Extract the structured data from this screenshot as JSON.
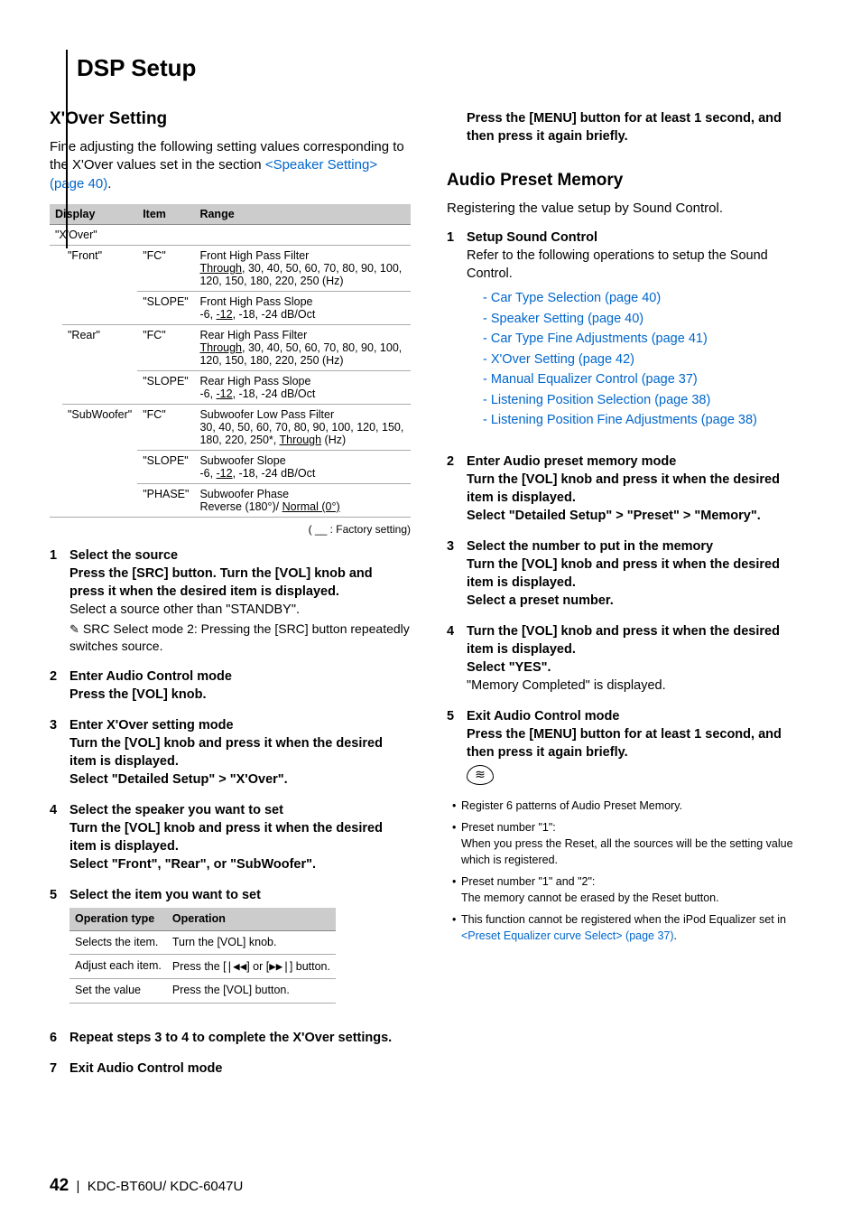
{
  "page": {
    "section_title": "DSP Setup",
    "footer_num": "42",
    "footer_sep": "|",
    "footer_models": "KDC-BT60U/ KDC-6047U"
  },
  "left": {
    "h2": "X'Over Setting",
    "intro_pre": "Fine adjusting the following setting values corresponding to the X'Over values set in the section ",
    "intro_link": "<Speaker Setting> (page 40)",
    "intro_post": ".",
    "table": {
      "headers": {
        "display": "Display",
        "item": "Item",
        "range": "Range"
      },
      "group_label": "\"X'Over\"",
      "rows": [
        {
          "display": "\"Front\"",
          "items": [
            {
              "item": "\"FC\"",
              "range_title": "Front High Pass Filter",
              "range_u": "Through",
              "range_rest": ", 30, 40, 50, 60, 70, 80, 90, 100, 120, 150, 180, 220, 250 (Hz)"
            },
            {
              "item": "\"SLOPE\"",
              "range_title": "Front High Pass Slope",
              "range_pre": "-6, ",
              "range_u": "-12",
              "range_rest": ", -18, -24 dB/Oct"
            }
          ]
        },
        {
          "display": "\"Rear\"",
          "items": [
            {
              "item": "\"FC\"",
              "range_title": "Rear High Pass Filter",
              "range_u": "Through",
              "range_rest": ", 30, 40, 50, 60, 70, 80, 90, 100, 120, 150, 180, 220, 250 (Hz)"
            },
            {
              "item": "\"SLOPE\"",
              "range_title": "Rear High Pass Slope",
              "range_pre": "-6, ",
              "range_u": "-12",
              "range_rest": ", -18, -24 dB/Oct"
            }
          ]
        },
        {
          "display": "\"SubWoofer\"",
          "items": [
            {
              "item": "\"FC\"",
              "range_title": "Subwoofer Low Pass Filter",
              "range_rest_pre": "30, 40, 50, 60, 70, 80, 90, 100, 120, 150, 180, 220, 250*, ",
              "range_u": "Through",
              "range_rest_post": " (Hz)"
            },
            {
              "item": "\"SLOPE\"",
              "range_title": "Subwoofer Slope",
              "range_pre": "-6, ",
              "range_u": "-12",
              "range_rest": ", -18, -24 dB/Oct"
            },
            {
              "item": "\"PHASE\"",
              "range_title": "Subwoofer Phase",
              "range_pre": "Reverse (180°)/ ",
              "range_u": "Normal (0°)"
            }
          ]
        }
      ]
    },
    "factory_text": "( __ : Factory setting)",
    "steps": [
      {
        "n": "1",
        "title": "Select the source",
        "bold": "Press the [SRC] button. Turn the [VOL] knob and press it when the desired item is displayed.",
        "plain": "Select a source other than \"STANDBY\".",
        "pen": "SRC Select mode 2: Pressing the [SRC] button repeatedly switches source."
      },
      {
        "n": "2",
        "title": "Enter Audio Control mode",
        "bold": "Press the [VOL] knob."
      },
      {
        "n": "3",
        "title": "Enter X'Over setting mode",
        "bold": "Turn the [VOL] knob and press it when the desired item is displayed.",
        "bold2_pre": "Select \"Detailed Setup\" ",
        "bold2_arrow": ">",
        "bold2_post": " \"X'Over\"."
      },
      {
        "n": "4",
        "title": "Select the speaker you want to set",
        "bold": "Turn the [VOL] knob and press it when the desired item is displayed.",
        "bold2": "Select \"Front\", \"Rear\", or \"SubWoofer\"."
      },
      {
        "n": "5",
        "title": "Select the item you want to set"
      },
      {
        "n": "6",
        "title": "Repeat steps 3 to 4 to complete the X'Over settings."
      },
      {
        "n": "7",
        "title": "Exit Audio Control mode"
      }
    ],
    "op_table": {
      "headers": {
        "type": "Operation type",
        "op": "Operation"
      },
      "rows": [
        {
          "type": "Selects the item.",
          "op": "Turn the [VOL] knob."
        },
        {
          "type": "Adjust each item.",
          "op_pre": "Press the [",
          "op_icon1": "|◀◀",
          "op_mid": "] or [",
          "op_icon2": "▶▶|",
          "op_post": "] button."
        },
        {
          "type": "Set the value",
          "op": "Press the [VOL] button."
        }
      ]
    }
  },
  "right": {
    "cont_bold": "Press the [MENU] button for at least 1 second, and then press it again briefly.",
    "h2": "Audio Preset Memory",
    "intro": "Registering the value setup by Sound Control.",
    "steps": [
      {
        "n": "1",
        "title": "Setup Sound Control",
        "plain": "Refer to the following operations to setup the Sound Control.",
        "links": [
          "Car Type Selection (page 40)",
          "Speaker Setting (page 40)",
          "Car Type Fine Adjustments (page 41)",
          "X'Over Setting (page 42)",
          "Manual Equalizer Control (page 37)",
          "Listening Position Selection (page 38)",
          "Listening Position Fine Adjustments (page 38)"
        ]
      },
      {
        "n": "2",
        "title": "Enter Audio preset memory mode",
        "bold": "Turn the [VOL] knob and press it when the desired item is displayed.",
        "bold2_pre": "Select \"Detailed Setup\" ",
        "arrow1": ">",
        "bold2_mid": " \"Preset\" ",
        "arrow2": ">",
        "bold2_post": " \"Memory\"."
      },
      {
        "n": "3",
        "title": "Select the number to put in the memory",
        "bold": "Turn the [VOL] knob and press it when the desired item is displayed.",
        "bold2": "Select a preset number."
      },
      {
        "n": "4",
        "title_pre": "Turn the [VOL] knob and press it when the desired item is displayed.",
        "bold2": "Select \"YES\".",
        "plain": "\"Memory Completed\" is displayed."
      },
      {
        "n": "5",
        "title": "Exit Audio Control mode",
        "bold": "Press the [MENU] button for at least 1 second, and then press it again briefly."
      }
    ],
    "bullets": [
      {
        "t": "Register 6 patterns of Audio Preset Memory."
      },
      {
        "t": "Preset number \"1\":",
        "sub": "When you press the Reset, all the sources will be the setting value which is registered."
      },
      {
        "t": "Preset number \"1\" and \"2\":",
        "sub": "The memory cannot be erased by the Reset button."
      },
      {
        "t_pre": "This function cannot be registered when the iPod Equalizer set in ",
        "link": "<Preset Equalizer curve Select> (page 37)",
        "t_post": "."
      }
    ]
  }
}
